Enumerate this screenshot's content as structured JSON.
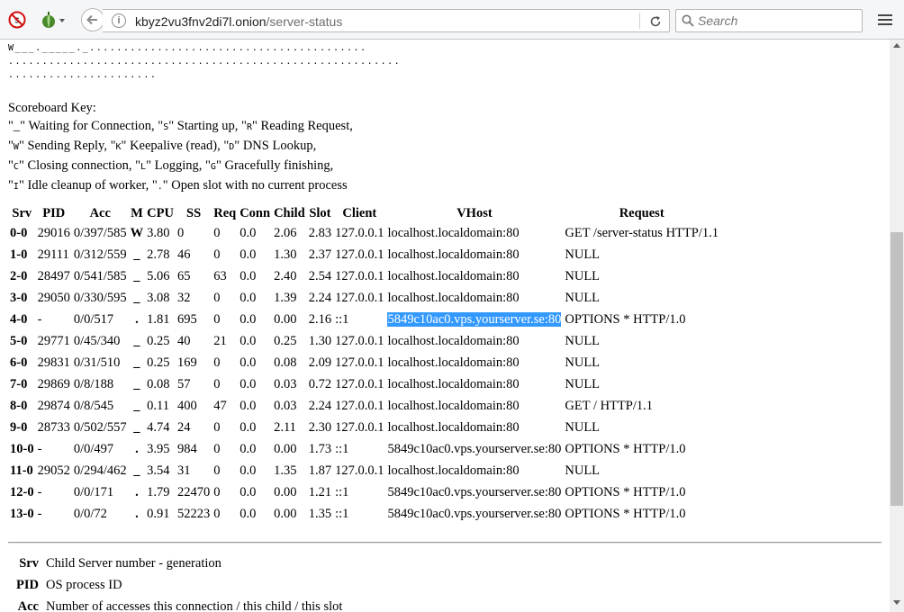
{
  "browser": {
    "url_host": "kbyz2vu3fnv2di7l.onion",
    "url_path": "/server-status",
    "search_placeholder": "Search"
  },
  "scoreboard_lines": [
    "W___._____._.........................................",
    "..........................................................",
    "......................"
  ],
  "key": {
    "title": "Scoreboard Key:",
    "lines": [
      [
        {
          "t": "\"_\" Waiting for Connection, \""
        },
        {
          "m": "S"
        },
        {
          "t": "\" Starting up, \""
        },
        {
          "m": "R"
        },
        {
          "t": "\" Reading Request,"
        }
      ],
      [
        {
          "t": "\""
        },
        {
          "m": "W"
        },
        {
          "t": "\" Sending Reply, \""
        },
        {
          "m": "K"
        },
        {
          "t": "\" Keepalive (read), \""
        },
        {
          "m": "D"
        },
        {
          "t": "\" DNS Lookup,"
        }
      ],
      [
        {
          "t": "\""
        },
        {
          "m": "C"
        },
        {
          "t": "\" Closing connection, \""
        },
        {
          "m": "L"
        },
        {
          "t": "\" Logging, \""
        },
        {
          "m": "G"
        },
        {
          "t": "\" Gracefully finishing,"
        }
      ],
      [
        {
          "t": "\""
        },
        {
          "m": "I"
        },
        {
          "t": "\" Idle cleanup of worker, \""
        },
        {
          "m": "."
        },
        {
          "t": "\" Open slot with no current process"
        }
      ]
    ]
  },
  "table": {
    "headers": [
      "Srv",
      "PID",
      "Acc",
      "M",
      "CPU",
      "SS",
      "Req",
      "Conn",
      "Child",
      "Slot",
      "Client",
      "VHost",
      "Request"
    ],
    "rows": [
      [
        "0-0",
        "29016",
        "0/397/585",
        "W",
        "3.80",
        "0",
        "0",
        "0.0",
        "2.06",
        "2.83",
        "127.0.0.1",
        "localhost.localdomain:80",
        "GET /server-status HTTP/1.1"
      ],
      [
        "1-0",
        "29111",
        "0/312/559",
        "_",
        "2.78",
        "46",
        "0",
        "0.0",
        "1.30",
        "2.37",
        "127.0.0.1",
        "localhost.localdomain:80",
        "NULL"
      ],
      [
        "2-0",
        "28497",
        "0/541/585",
        "_",
        "5.06",
        "65",
        "63",
        "0.0",
        "2.40",
        "2.54",
        "127.0.0.1",
        "localhost.localdomain:80",
        "NULL"
      ],
      [
        "3-0",
        "29050",
        "0/330/595",
        "_",
        "3.08",
        "32",
        "0",
        "0.0",
        "1.39",
        "2.24",
        "127.0.0.1",
        "localhost.localdomain:80",
        "NULL"
      ],
      [
        "4-0",
        "-",
        "0/0/517",
        ".",
        "1.81",
        "695",
        "0",
        "0.0",
        "0.00",
        "2.16",
        "::1",
        "5849c10ac0.vps.yourserver.se:80",
        "OPTIONS * HTTP/1.0"
      ],
      [
        "5-0",
        "29771",
        "0/45/340",
        "_",
        "0.25",
        "40",
        "21",
        "0.0",
        "0.25",
        "1.30",
        "127.0.0.1",
        "localhost.localdomain:80",
        "NULL"
      ],
      [
        "6-0",
        "29831",
        "0/31/510",
        "_",
        "0.25",
        "169",
        "0",
        "0.0",
        "0.08",
        "2.09",
        "127.0.0.1",
        "localhost.localdomain:80",
        "NULL"
      ],
      [
        "7-0",
        "29869",
        "0/8/188",
        "_",
        "0.08",
        "57",
        "0",
        "0.0",
        "0.03",
        "0.72",
        "127.0.0.1",
        "localhost.localdomain:80",
        "NULL"
      ],
      [
        "8-0",
        "29874",
        "0/8/545",
        "_",
        "0.11",
        "400",
        "47",
        "0.0",
        "0.03",
        "2.24",
        "127.0.0.1",
        "localhost.localdomain:80",
        "GET / HTTP/1.1"
      ],
      [
        "9-0",
        "28733",
        "0/502/557",
        "_",
        "4.74",
        "24",
        "0",
        "0.0",
        "2.11",
        "2.30",
        "127.0.0.1",
        "localhost.localdomain:80",
        "NULL"
      ],
      [
        "10-0",
        "-",
        "0/0/497",
        ".",
        "3.95",
        "984",
        "0",
        "0.0",
        "0.00",
        "1.73",
        "::1",
        "5849c10ac0.vps.yourserver.se:80",
        "OPTIONS * HTTP/1.0"
      ],
      [
        "11-0",
        "29052",
        "0/294/462",
        "_",
        "3.54",
        "31",
        "0",
        "0.0",
        "1.35",
        "1.87",
        "127.0.0.1",
        "localhost.localdomain:80",
        "NULL"
      ],
      [
        "12-0",
        "-",
        "0/0/171",
        ".",
        "1.79",
        "22470",
        "0",
        "0.0",
        "0.00",
        "1.21",
        "::1",
        "5849c10ac0.vps.yourserver.se:80",
        "OPTIONS * HTTP/1.0"
      ],
      [
        "13-0",
        "-",
        "0/0/72",
        ".",
        "0.91",
        "52223",
        "0",
        "0.0",
        "0.00",
        "1.35",
        "::1",
        "5849c10ac0.vps.yourserver.se:80",
        "OPTIONS * HTTP/1.0"
      ]
    ],
    "selected_cell": {
      "row": 4,
      "col": 11
    }
  },
  "legend": [
    {
      "abbr": "Srv",
      "desc": "Child Server number - generation"
    },
    {
      "abbr": "PID",
      "desc": "OS process ID"
    },
    {
      "abbr": "Acc",
      "desc": "Number of accesses this connection / this child / this slot"
    }
  ],
  "colors": {
    "selection": "#3399ff",
    "toolbar": "#f5f6f7"
  }
}
